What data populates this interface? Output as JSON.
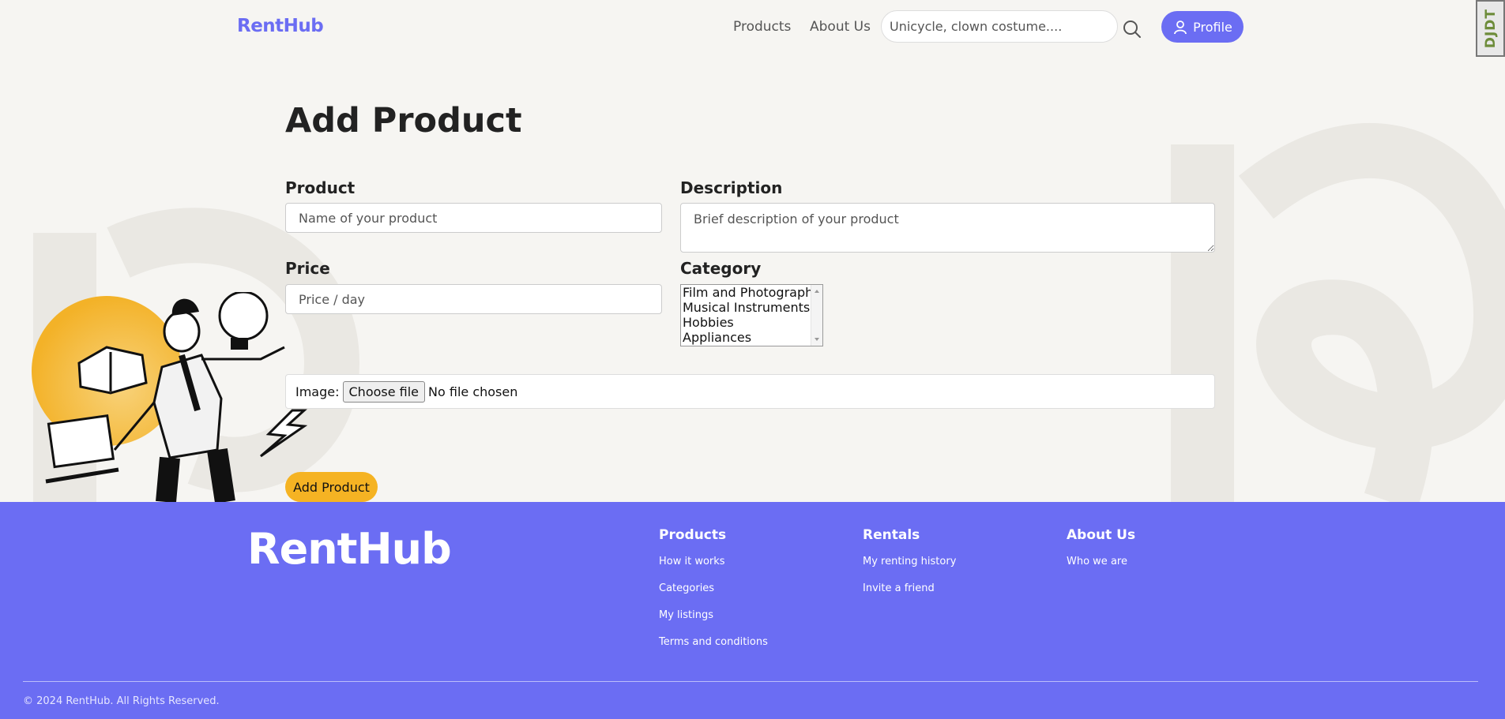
{
  "header": {
    "logo": "RentHub",
    "nav": [
      "Products",
      "About Us"
    ],
    "search_placeholder": "Unicycle, clown costume....",
    "profile_label": "Profile",
    "debug_toolbar": "DJDT"
  },
  "form": {
    "title": "Add Product",
    "product_label": "Product",
    "product_placeholder": "Name of your product",
    "description_label": "Description",
    "description_placeholder": "Brief description of your product",
    "price_label": "Price",
    "price_placeholder": "Price / day",
    "category_label": "Category",
    "category_options": [
      "Film and Photography",
      "Musical Instruments",
      "Hobbies",
      "Appliances"
    ],
    "image_label": "Image:",
    "choose_file": "Choose file",
    "no_file": "No file chosen",
    "submit": "Add Product"
  },
  "footer": {
    "logo": "RentHub",
    "columns": [
      {
        "heading": "Products",
        "links": [
          "How it works",
          "Categories",
          "My listings",
          "Terms and conditions"
        ]
      },
      {
        "heading": "Rentals",
        "links": [
          "My renting history",
          "Invite a friend"
        ]
      },
      {
        "heading": "About Us",
        "links": [
          "Who we are"
        ]
      }
    ],
    "copyright": "© 2024 RentHub. All Rights Reserved."
  },
  "colors": {
    "brand": "#6b6df3",
    "accent": "#f5b323",
    "background": "#f6f5f2"
  }
}
